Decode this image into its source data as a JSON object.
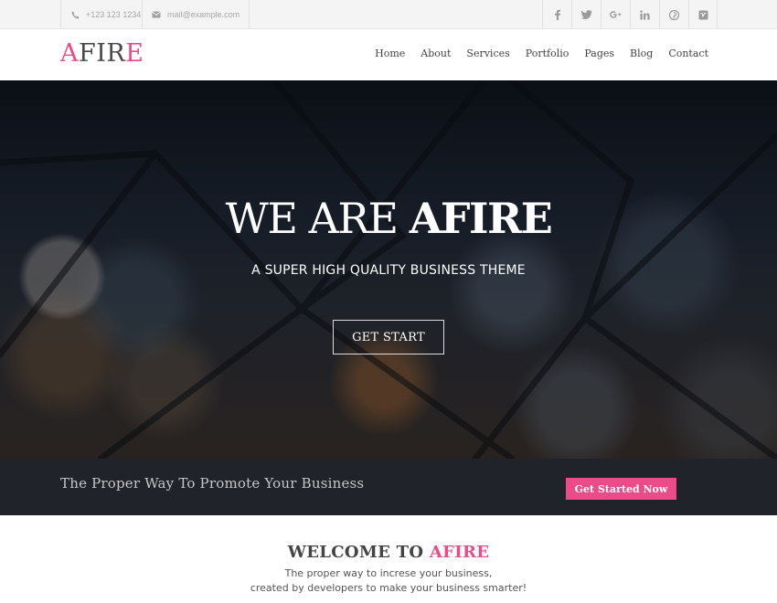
{
  "topbar": {
    "phone": "+123 123 1234",
    "email": "mail@example.com",
    "icons": [
      "phone-icon",
      "envelope-icon"
    ],
    "social": [
      "facebook-icon",
      "twitter-icon",
      "google-plus-icon",
      "linkedin-icon",
      "pinterest-icon",
      "vimeo-icon"
    ]
  },
  "header": {
    "logo": {
      "first": "A",
      "middle": "FIR",
      "last": "E"
    },
    "nav": [
      "Home",
      "About",
      "Services",
      "Portfolio",
      "Pages",
      "Blog",
      "Contact"
    ]
  },
  "hero": {
    "title_light": "WE ARE ",
    "title_bold": "AFIRE",
    "subtitle": "A SUPER HIGH QUALITY BUSINESS THEME",
    "button": "GET START"
  },
  "promo": {
    "text": "The Proper Way To Promote Your Business",
    "button": "Get Started Now"
  },
  "welcome": {
    "title_prefix": "WELCOME TO ",
    "title_accent": "AFIRE",
    "line1": "The proper way to increse your business,",
    "line2": "created by developers to make your business smarter!"
  },
  "colors": {
    "accent": "#ea4c89",
    "promo_bg": "#20232a",
    "topbar_bg": "#f4f4f4"
  }
}
